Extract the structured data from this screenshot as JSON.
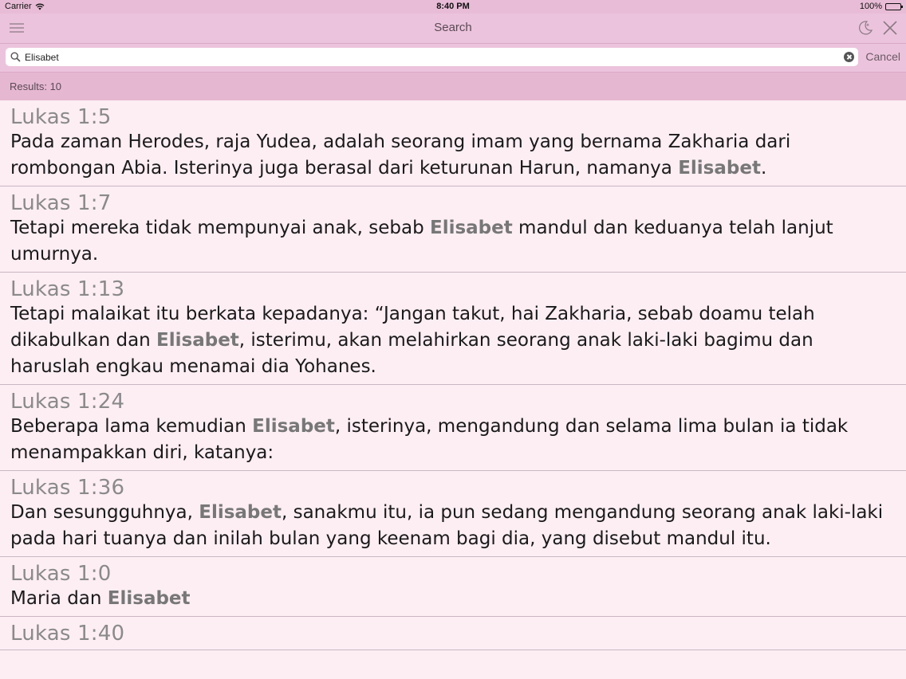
{
  "status_bar": {
    "carrier": "Carrier",
    "time": "8:40 PM",
    "battery": "100%"
  },
  "nav": {
    "title": "Search"
  },
  "search": {
    "value": "Elisabet",
    "cancel_label": "Cancel"
  },
  "results_count_label": "Results: 10",
  "highlight_term": "Elisabet",
  "results": [
    {
      "ref": "Lukas 1:5",
      "before": "Pada zaman Herodes, raja Yudea, adalah seorang imam yang bernama Zakharia dari rombongan Abia. Isterinya juga berasal dari keturunan Harun, namanya ",
      "after": "."
    },
    {
      "ref": "Lukas 1:7",
      "before": "Tetapi mereka tidak mempunyai anak, sebab ",
      "after": " mandul dan keduanya telah lanjut umurnya."
    },
    {
      "ref": "Lukas 1:13",
      "before": "Tetapi malaikat itu berkata kepadanya: “Jangan takut, hai Zakharia, sebab doamu telah dikabulkan dan ",
      "after": ", isterimu, akan melahirkan seorang anak laki-laki bagimu dan haruslah engkau menamai dia Yohanes."
    },
    {
      "ref": "Lukas 1:24",
      "before": "Beberapa lama kemudian ",
      "after": ", isterinya, mengandung dan selama lima bulan ia tidak menampakkan diri, katanya:"
    },
    {
      "ref": "Lukas 1:36",
      "before": "Dan sesungguhnya, ",
      "after": ", sanakmu itu, ia pun sedang mengandung seorang anak laki-laki pada hari tuanya dan inilah bulan yang keenam bagi dia, yang disebut mandul itu."
    },
    {
      "ref": "Lukas 1:0",
      "before": "Maria dan ",
      "after": ""
    },
    {
      "ref": "Lukas 1:40",
      "before": "",
      "after": ""
    }
  ]
}
